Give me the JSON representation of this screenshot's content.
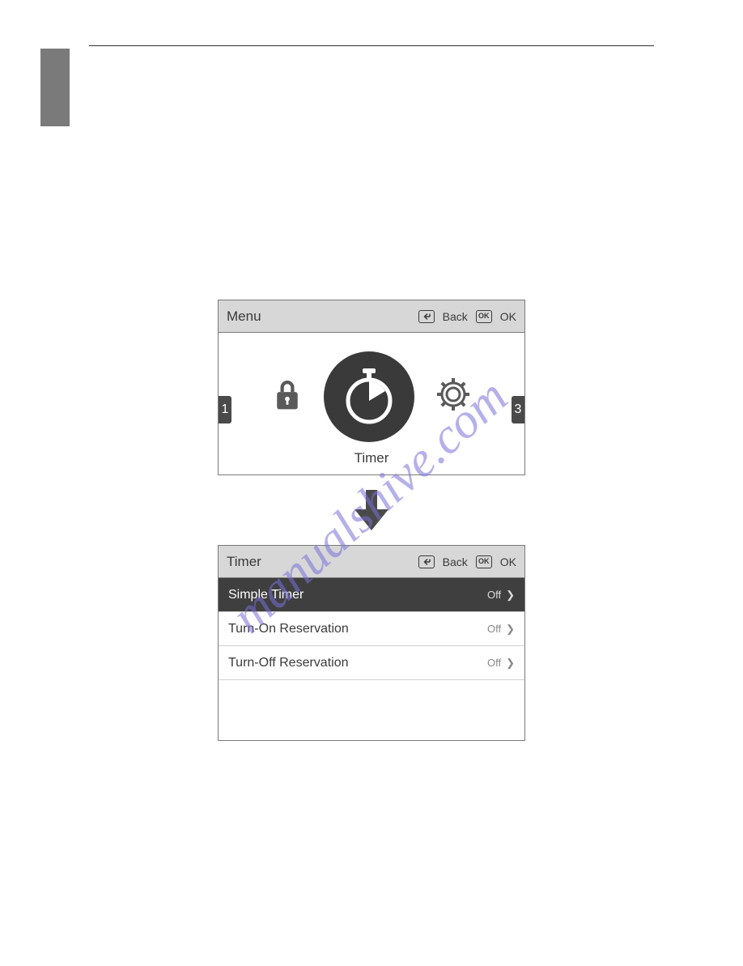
{
  "menu_panel": {
    "title": "Menu",
    "back_label": "Back",
    "ok_label": "OK",
    "ok_box": "OK",
    "selected_label": "Timer",
    "left_fragment": "1",
    "right_fragment": "3"
  },
  "timer_panel": {
    "title": "Timer",
    "back_label": "Back",
    "ok_label": "OK",
    "ok_box": "OK",
    "rows": [
      {
        "label": "Simple Timer",
        "status": "Off",
        "selected": true
      },
      {
        "label": "Turn-On Reservation",
        "status": "Off",
        "selected": false
      },
      {
        "label": "Turn-Off Reservation",
        "status": "Off",
        "selected": false
      }
    ]
  },
  "watermark": "manualshive.com"
}
